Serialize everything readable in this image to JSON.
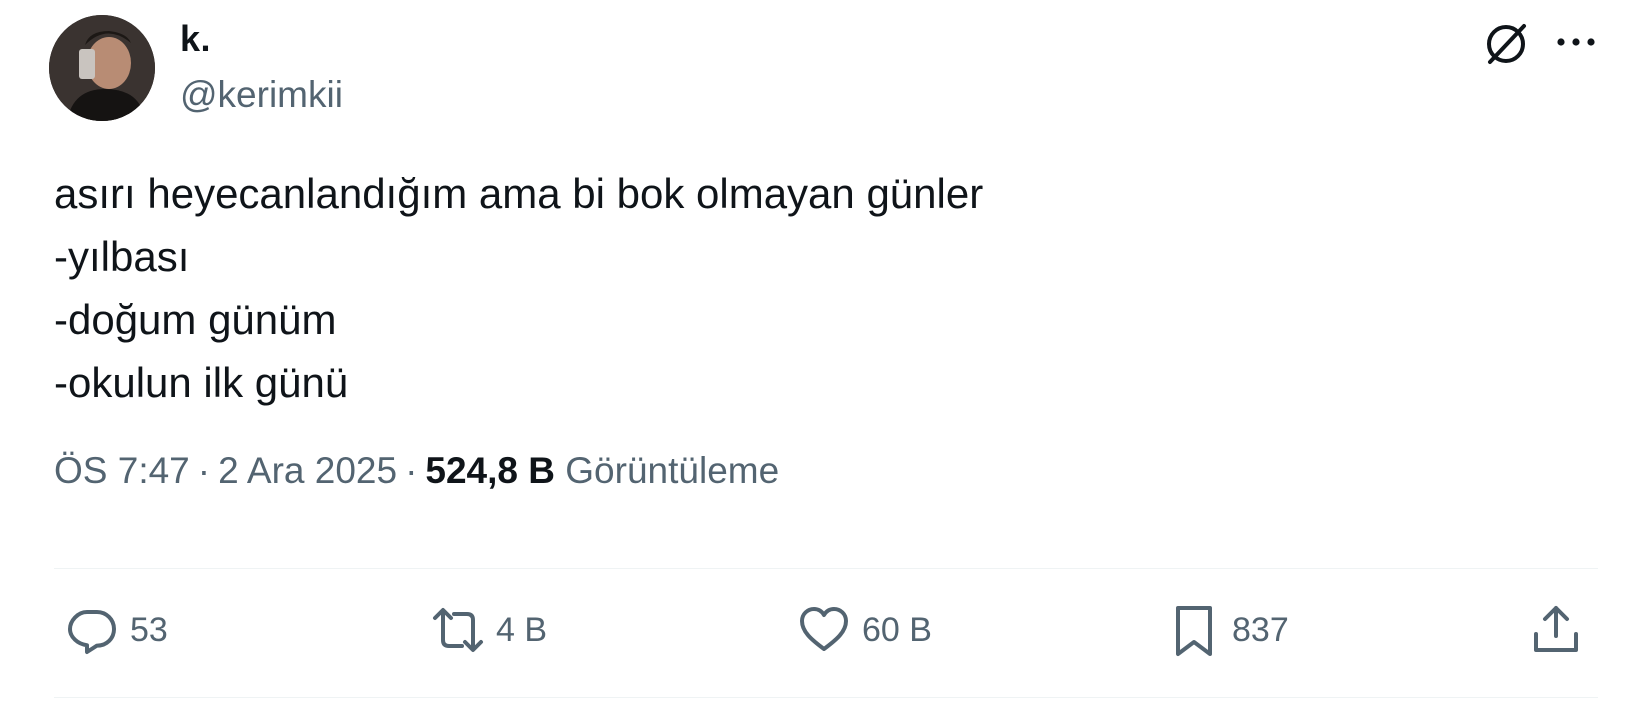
{
  "author": {
    "name": "k.",
    "handle": "@kerimkii"
  },
  "tweet": {
    "lines": [
      "asırı heyecanlandığım ama bi bok olmayan günler",
      "-yılbası",
      "-doğum günüm",
      "-okulun ilk günü"
    ]
  },
  "meta": {
    "time": "ÖS 7:47",
    "separator": "·",
    "date": "2 Ara 2025",
    "views_count": "524,8 B",
    "views_label": "Görüntüleme"
  },
  "actions": {
    "reply_count": "53",
    "retweet_count": "4 B",
    "like_count": "60 B",
    "bookmark_count": "837"
  },
  "icons": {
    "header": [
      "grok-icon",
      "more-options-icon"
    ],
    "actions": [
      "reply-icon",
      "retweet-icon",
      "like-icon",
      "bookmark-icon",
      "share-icon"
    ]
  },
  "colors": {
    "text_primary": "#0f1419",
    "text_secondary": "#536471",
    "divider": "#eff3f4"
  }
}
